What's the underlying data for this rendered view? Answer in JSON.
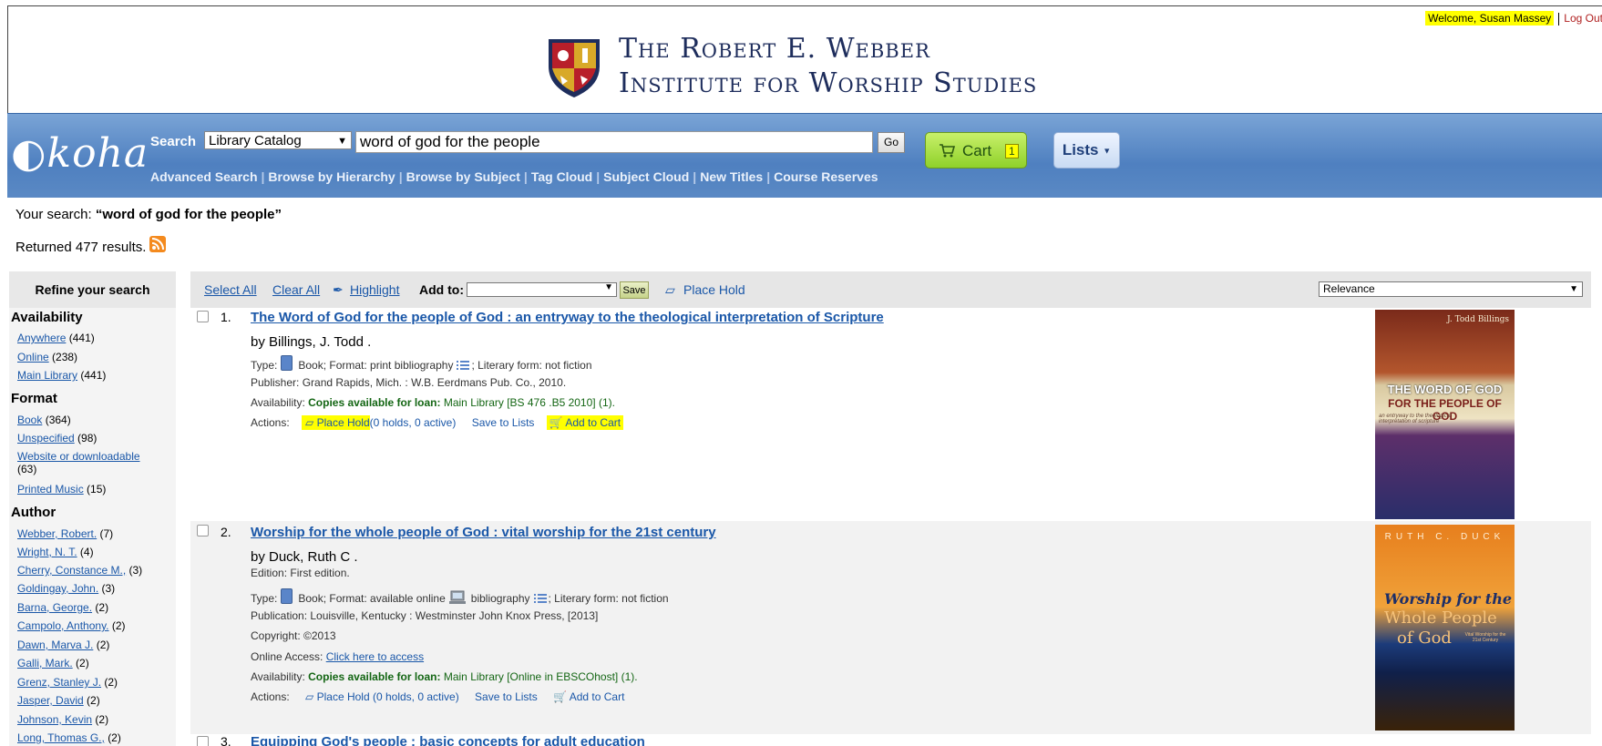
{
  "header": {
    "welcome_prefix": "Welcome, ",
    "user_name": "Susan Massey",
    "logout": "Log Out",
    "institute_line1": "The Robert E. Webber",
    "institute_line2": "Institute for Worship Studies"
  },
  "searchbar": {
    "logo": "koha",
    "search_label": "Search",
    "catalog_option": "Library Catalog",
    "query": "word of god for the people",
    "go": "Go",
    "cart_label": "Cart",
    "cart_count": "1",
    "lists_label": "Lists",
    "links": [
      "Advanced Search",
      "Browse by Hierarchy",
      "Browse by Subject",
      "Tag Cloud",
      "Subject Cloud",
      "New Titles",
      "Course Reserves"
    ]
  },
  "summary": {
    "your_search_label": "Your search: ",
    "your_search_query": "“word of god for the people”",
    "returned": "Returned 477 results."
  },
  "refine": {
    "title": "Refine your search",
    "availability": {
      "heading": "Availability",
      "items": [
        {
          "label": "Anywhere",
          "count": "(441)"
        },
        {
          "label": "Online",
          "count": "(238)"
        },
        {
          "label": "Main Library",
          "count": "(441)"
        }
      ]
    },
    "format": {
      "heading": "Format",
      "items": [
        {
          "label": "Book",
          "count": "(364)"
        },
        {
          "label": "Unspecified",
          "count": "(98)"
        },
        {
          "label": "Website or downloadable",
          "count": "(63)"
        },
        {
          "label": "Printed Music",
          "count": "(15)"
        }
      ]
    },
    "author": {
      "heading": "Author",
      "items": [
        {
          "label": "Webber, Robert.",
          "count": "(7)"
        },
        {
          "label": "Wright, N. T.",
          "count": "(4)"
        },
        {
          "label": "Cherry, Constance M.,",
          "count": "(3)"
        },
        {
          "label": "Goldingay, John.",
          "count": "(3)"
        },
        {
          "label": "Barna, George.",
          "count": "(2)"
        },
        {
          "label": "Campolo, Anthony.",
          "count": "(2)"
        },
        {
          "label": "Dawn, Marva J.",
          "count": "(2)"
        },
        {
          "label": "Galli, Mark.",
          "count": "(2)"
        },
        {
          "label": "Grenz, Stanley J.",
          "count": "(2)"
        },
        {
          "label": "Jasper, David",
          "count": "(2)"
        },
        {
          "label": "Johnson, Kevin",
          "count": "(2)"
        },
        {
          "label": "Long, Thomas G.,",
          "count": "(2)"
        }
      ]
    }
  },
  "toolbar": {
    "select_all": "Select All",
    "clear_all": "Clear All",
    "highlight": "Highlight",
    "add_to": "Add to:",
    "save": "Save",
    "place_hold": "Place Hold",
    "sort": "Relevance"
  },
  "results": [
    {
      "num": "1.",
      "title": "The Word of God for the people of God : an entryway to the theological interpretation of Scripture",
      "author": "by Billings, J. Todd .",
      "type_prefix": "Type:",
      "type_text": "Book; Format: print bibliography",
      "type_suffix": "; Literary form: not fiction",
      "publisher": "Publisher: Grand Rapids, Mich. : W.B. Eerdmans Pub. Co., 2010.",
      "availability_label": "Availability: ",
      "availability_strong": "Copies available for loan:",
      "availability_rest": " Main Library [BS 476 .B5 2010] (1).",
      "actions_label": "Actions:",
      "place_hold": "Place Hold",
      "holds": "(0 holds, 0 active)",
      "save_to_lists": "Save to Lists",
      "add_to_cart": "Add to Cart",
      "cover": {
        "author": "J. Todd Billings",
        "title1": "THE WORD OF GOD",
        "title2": "FOR THE PEOPLE OF GOD",
        "subtitle": "an entryway to the theological interpretation of scripture"
      }
    },
    {
      "num": "2.",
      "title": "Worship for the whole people of God : vital worship for the 21st century",
      "author": "by Duck, Ruth C .",
      "edition": "Edition: First edition.",
      "type_prefix": "Type:",
      "type_text": "Book; Format: available online",
      "type_mid": "bibliography",
      "type_suffix": "; Literary form: not fiction",
      "publication": "Publication: Louisville, Kentucky : Westminster John Knox Press, [2013]",
      "copyright": "Copyright: ©2013",
      "online_label": "Online Access: ",
      "online_link": "Click here to access",
      "availability_label": "Availability: ",
      "availability_strong": "Copies available for loan:",
      "availability_rest": " Main Library [Online in EBSCOhost] (1).",
      "actions_label": "Actions:",
      "place_hold": "Place Hold",
      "holds": "(0 holds, 0 active)",
      "save_to_lists": "Save to Lists",
      "add_to_cart": "Add to Cart",
      "cover": {
        "author": "RUTH C. DUCK",
        "title1": "Worship for the",
        "title2": "Whole People",
        "title3": "of God",
        "subtitle": "Vital Worship for the 21st Century"
      }
    },
    {
      "num": "3.",
      "title": "Equipping God's people : basic concepts for adult education"
    }
  ]
}
